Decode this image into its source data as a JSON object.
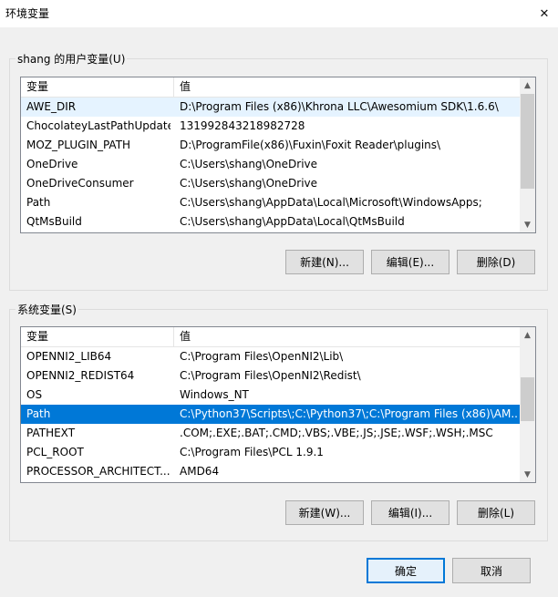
{
  "window": {
    "title": "环境变量",
    "close_glyph": "✕"
  },
  "user_vars": {
    "legend": "shang 的用户变量(U)",
    "col_name": "变量",
    "col_value": "值",
    "rows": [
      {
        "name": "AWE_DIR",
        "value": "D:\\Program Files (x86)\\Khrona LLC\\Awesomium SDK\\1.6.6\\"
      },
      {
        "name": "ChocolateyLastPathUpdate",
        "value": "131992843218982728"
      },
      {
        "name": "MOZ_PLUGIN_PATH",
        "value": "D:\\ProgramFile(x86)\\Fuxin\\Foxit Reader\\plugins\\"
      },
      {
        "name": "OneDrive",
        "value": "C:\\Users\\shang\\OneDrive"
      },
      {
        "name": "OneDriveConsumer",
        "value": "C:\\Users\\shang\\OneDrive"
      },
      {
        "name": "Path",
        "value": "C:\\Users\\shang\\AppData\\Local\\Microsoft\\WindowsApps;"
      },
      {
        "name": "QtMsBuild",
        "value": "C:\\Users\\shang\\AppData\\Local\\QtMsBuild"
      }
    ],
    "buttons": {
      "new": "新建(N)...",
      "edit": "编辑(E)...",
      "delete": "删除(D)"
    }
  },
  "system_vars": {
    "legend": "系统变量(S)",
    "col_name": "变量",
    "col_value": "值",
    "rows": [
      {
        "name": "OPENNI2_LIB64",
        "value": "C:\\Program Files\\OpenNI2\\Lib\\"
      },
      {
        "name": "OPENNI2_REDIST64",
        "value": "C:\\Program Files\\OpenNI2\\Redist\\"
      },
      {
        "name": "OS",
        "value": "Windows_NT"
      },
      {
        "name": "Path",
        "value": "C:\\Python37\\Scripts\\;C:\\Python37\\;C:\\Program Files (x86)\\AM..."
      },
      {
        "name": "PATHEXT",
        "value": ".COM;.EXE;.BAT;.CMD;.VBS;.VBE;.JS;.JSE;.WSF;.WSH;.MSC"
      },
      {
        "name": "PCL_ROOT",
        "value": "C:\\Program Files\\PCL 1.9.1"
      },
      {
        "name": "PROCESSOR_ARCHITECT...",
        "value": "AMD64"
      }
    ],
    "selected_row": "Path",
    "buttons": {
      "new": "新建(W)...",
      "edit": "编辑(I)...",
      "delete": "删除(L)"
    }
  },
  "footer": {
    "ok": "确定",
    "cancel": "取消"
  },
  "icons": {
    "scroll_up": "▲",
    "scroll_down": "▼"
  },
  "colors": {
    "selection": "#0078d7",
    "hover": "#e5f3ff",
    "default_button_border": "#0078d7"
  }
}
